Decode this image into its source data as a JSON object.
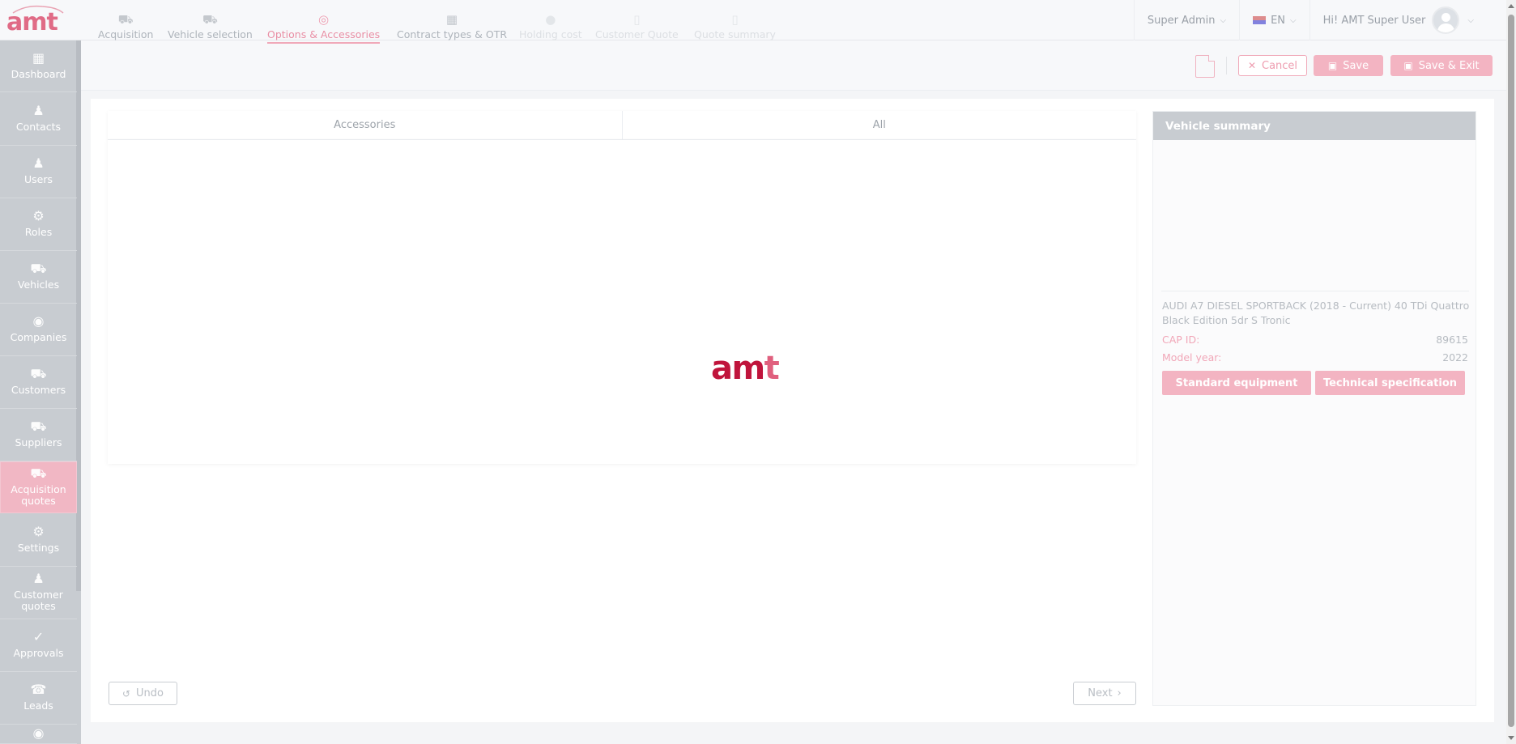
{
  "app": {
    "logo_text": "amt"
  },
  "topbar": {
    "role": "Super Admin",
    "language": "EN",
    "greeting": "Hi! AMT Super User"
  },
  "sidebar": {
    "items": [
      {
        "label": "Dashboard",
        "icon": "dashboard-icon"
      },
      {
        "label": "Contacts",
        "icon": "contacts-icon"
      },
      {
        "label": "Users",
        "icon": "user-icon"
      },
      {
        "label": "Roles",
        "icon": "roles-icon"
      },
      {
        "label": "Vehicles",
        "icon": "car-icon"
      },
      {
        "label": "Companies",
        "icon": "companies-icon"
      },
      {
        "label": "Customers",
        "icon": "customers-icon"
      },
      {
        "label": "Suppliers",
        "icon": "suppliers-icon"
      },
      {
        "label": "Acquisition quotes",
        "icon": "acquisition-icon",
        "active": true
      },
      {
        "label": "Settings",
        "icon": "gear-icon"
      },
      {
        "label": "Customer quotes",
        "icon": "customer-quotes-icon"
      },
      {
        "label": "Approvals",
        "icon": "approvals-icon"
      },
      {
        "label": "Leads",
        "icon": "leads-icon"
      }
    ]
  },
  "steps": [
    {
      "label": "Acquisition"
    },
    {
      "label": "Vehicle selection"
    },
    {
      "label": "Options & Accessories",
      "active": true
    },
    {
      "label": "Contract types & OTR"
    },
    {
      "label": "Holding cost"
    },
    {
      "label": "Customer Quote"
    },
    {
      "label": "Quote summary"
    }
  ],
  "actions": {
    "cancel": "Cancel",
    "save": "Save",
    "save_exit": "Save & Exit"
  },
  "tabs": [
    "Accessories",
    "All"
  ],
  "loader": {
    "logo_main": "am",
    "logo_t": "t"
  },
  "footer": {
    "undo": "Undo",
    "next": "Next"
  },
  "vehicle_summary": {
    "title": "Vehicle summary",
    "name": "AUDI A7 DIESEL SPORTBACK (2018 - Current) 40 TDi Quattro Black Edition 5dr S Tronic",
    "cap_id_label": "CAP ID:",
    "cap_id": "89615",
    "model_year_label": "Model year:",
    "model_year": "2022",
    "standard_equipment": "Standard equipment",
    "technical_specification": "Technical specification"
  },
  "colors": {
    "accent": "#f3b4c2",
    "brand": "#c0143c",
    "sidebar_bg": "#c8ccd1"
  }
}
